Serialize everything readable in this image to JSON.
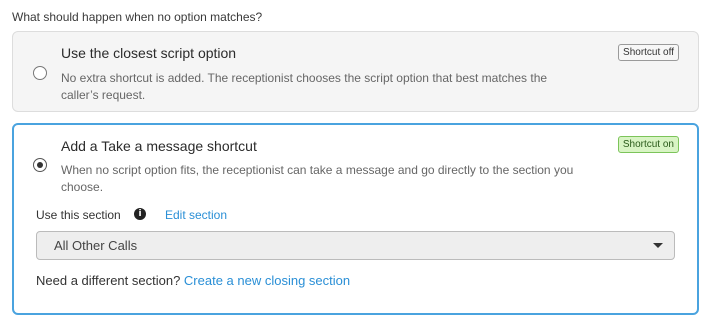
{
  "question": "What should happen when no option matches?",
  "options": [
    {
      "title": "Use the closest script option",
      "description": "No extra shortcut is added. The receptionist chooses the script option that best matches the caller’s request.",
      "badge": "Shortcut off",
      "selected": false
    },
    {
      "title": "Add a Take a message shortcut",
      "description": "When no script option fits, the receptionist can take a message and go directly to the section you choose.",
      "badge": "Shortcut on",
      "selected": true
    }
  ],
  "section": {
    "label": "Use this section",
    "edit_link": "Edit section",
    "selected_value": "All Other Calls",
    "helper_text": "Need a different section?",
    "create_link": "Create a new closing section"
  },
  "colors": {
    "accent": "#4aa3df",
    "link": "#2a8fd6",
    "badge_on_bg": "#d8f4c4"
  }
}
